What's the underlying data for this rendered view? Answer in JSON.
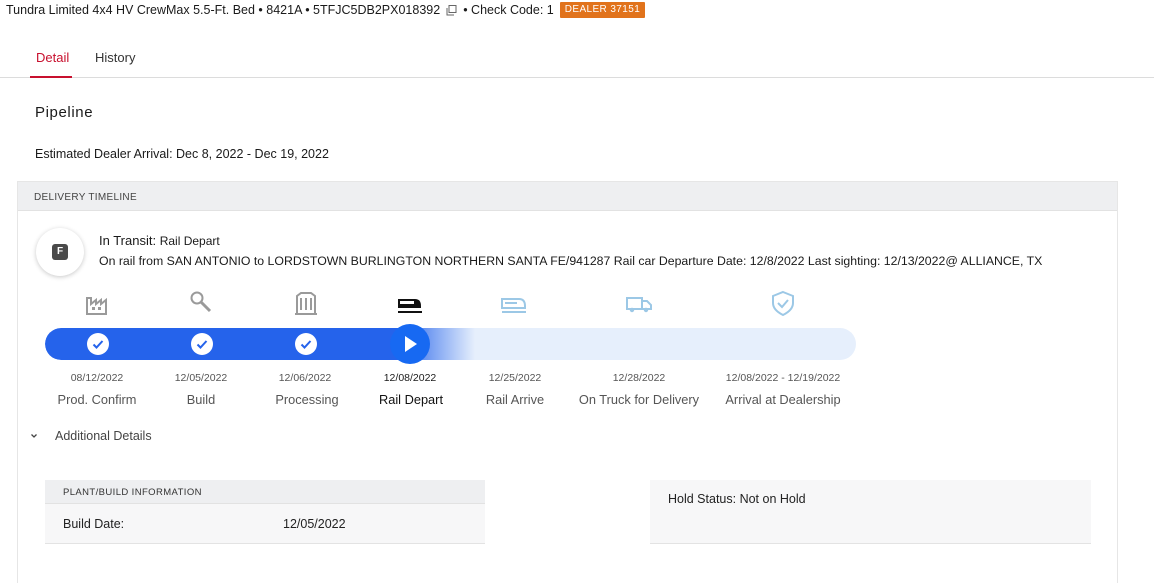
{
  "header": {
    "vehicle_title": "Tundra Limited 4x4 HV CrewMax 5.5-Ft. Bed • 8421A • 5TFJC5DB2PX018392",
    "copy_icon": "copy-icon",
    "check_code": "• Check Code: 1",
    "dealer_badge": "DEALER 37151",
    "badge_color": "#e1731c"
  },
  "tabs": [
    {
      "label": "Detail",
      "active": true
    },
    {
      "label": "History",
      "active": false
    }
  ],
  "pipeline": {
    "title": "Pipeline",
    "estimated_arrival": "Estimated Dealer Arrival: Dec 8, 2022 - Dec 19, 2022"
  },
  "timeline": {
    "header": "DELIVERY TIMELINE",
    "status_badge_letter": "F",
    "status_label": "In Transit:",
    "status_value": "Rail Depart",
    "status_description": "On rail from SAN ANTONIO to LORDSTOWN BURLINGTON NORTHERN SANTA FE/941287 Rail car Departure Date: 12/8/2022 Last sighting: 12/13/2022@ ALLIANCE, TX",
    "progress_color": "#2563eb",
    "steps": [
      {
        "date": "08/12/2022",
        "label": "Prod. Confirm",
        "icon": "factory-icon",
        "state": "done"
      },
      {
        "date": "12/05/2022",
        "label": "Build",
        "icon": "wrench-icon",
        "state": "done"
      },
      {
        "date": "12/06/2022",
        "label": "Processing",
        "icon": "processing-icon",
        "state": "done"
      },
      {
        "date": "12/08/2022",
        "label": "Rail Depart",
        "icon": "train-icon",
        "state": "current"
      },
      {
        "date": "12/25/2022",
        "label": "Rail Arrive",
        "icon": "rail-arrive-icon",
        "state": "upcoming"
      },
      {
        "date": "12/28/2022",
        "label": "On Truck for Delivery",
        "icon": "truck-icon",
        "state": "upcoming"
      },
      {
        "date": "12/08/2022 - 12/19/2022",
        "label": "Arrival at Dealership",
        "icon": "shield-check-icon",
        "state": "upcoming"
      }
    ]
  },
  "additional_details": {
    "label": "Additional Details",
    "plant_header": "PLANT/BUILD INFORMATION",
    "build_date_label": "Build Date:",
    "build_date_value": "12/05/2022",
    "hold_status": "Hold Status: Not on Hold"
  }
}
